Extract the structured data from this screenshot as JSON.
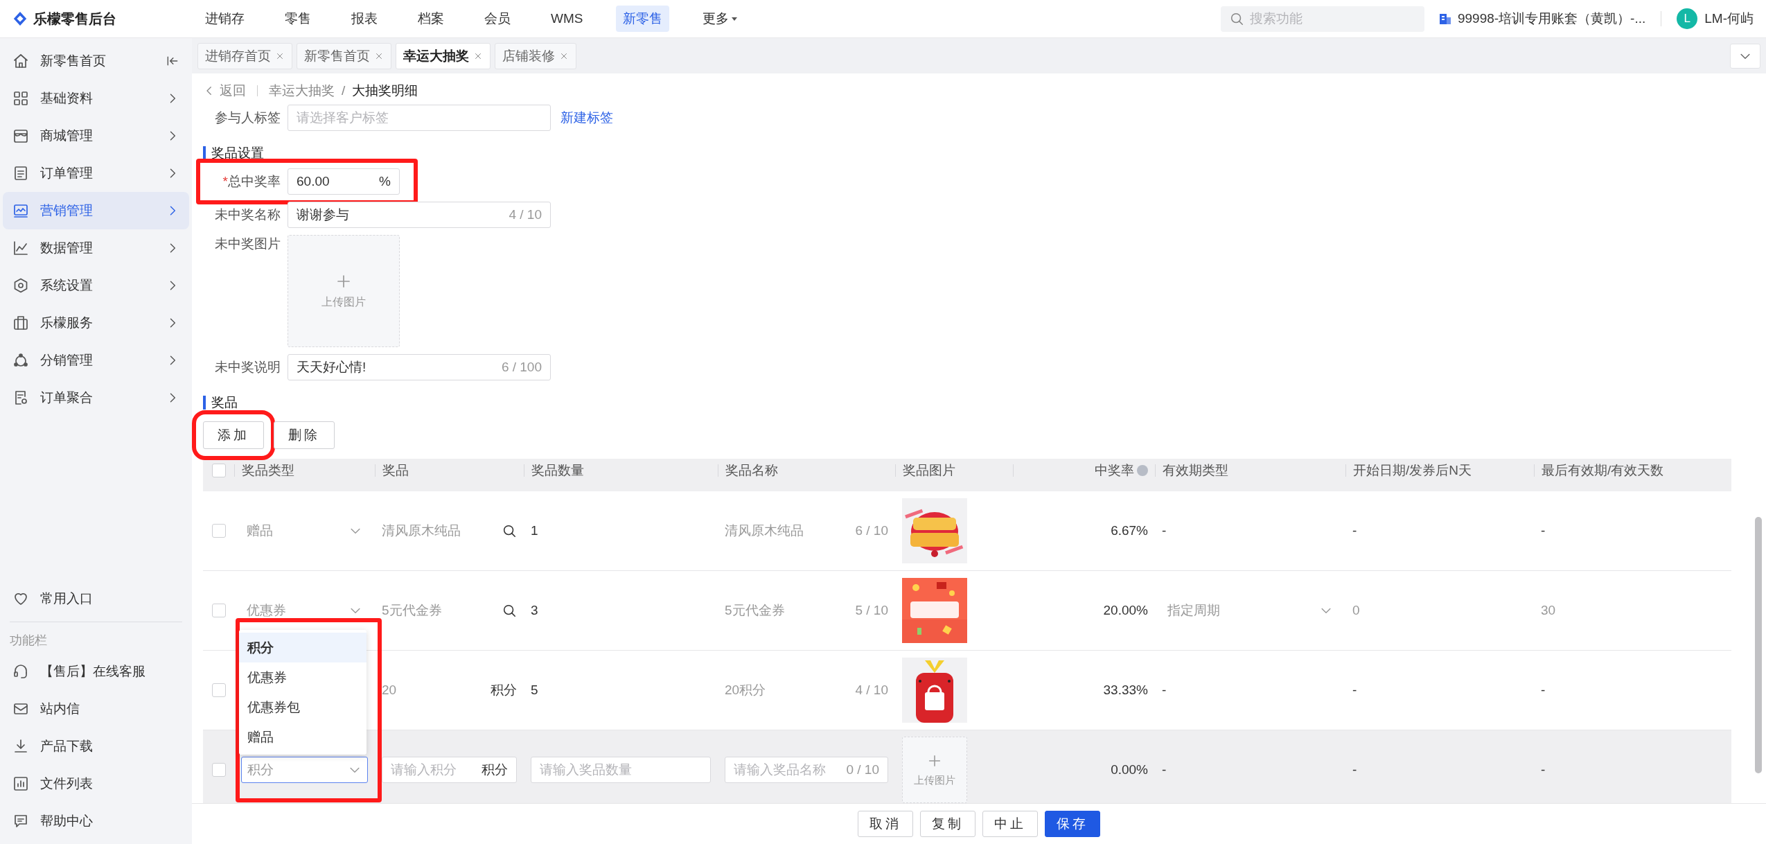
{
  "app": {
    "title": "乐檬零售后台"
  },
  "top_nav": [
    {
      "label": "进销存",
      "selected": false,
      "kind": "link"
    },
    {
      "label": "零售",
      "selected": false,
      "kind": "link"
    },
    {
      "label": "报表",
      "selected": false,
      "kind": "link"
    },
    {
      "label": "档案",
      "selected": false,
      "kind": "link"
    },
    {
      "label": "会员",
      "selected": false,
      "kind": "link"
    },
    {
      "label": "WMS",
      "selected": false,
      "kind": "link"
    },
    {
      "label": "新零售",
      "selected": true,
      "kind": "link"
    },
    {
      "label": "更多",
      "selected": false,
      "kind": "menu"
    }
  ],
  "search": {
    "placeholder": "搜索功能"
  },
  "account": {
    "label": "99998-培训专用账套（黄凯）-..."
  },
  "user": {
    "initial": "L",
    "name": "LM-何屿"
  },
  "sidebar": {
    "items": [
      {
        "label": "新零售首页",
        "selected": false,
        "kind": "collapse"
      },
      {
        "label": "基础资料",
        "selected": false,
        "kind": "chevron"
      },
      {
        "label": "商城管理",
        "selected": false,
        "kind": "chevron"
      },
      {
        "label": "订单管理",
        "selected": false,
        "kind": "chevron"
      },
      {
        "label": "营销管理",
        "selected": true,
        "kind": "chevron"
      },
      {
        "label": "数据管理",
        "selected": false,
        "kind": "chevron"
      },
      {
        "label": "系统设置",
        "selected": false,
        "kind": "chevron"
      },
      {
        "label": "乐檬服务",
        "selected": false,
        "kind": "chevron"
      },
      {
        "label": "分销管理",
        "selected": false,
        "kind": "chevron"
      },
      {
        "label": "订单聚合",
        "selected": false,
        "kind": "chevron"
      }
    ],
    "favorites": {
      "label": "常用入口"
    },
    "section_title": "功能栏",
    "tools": [
      {
        "label": "【售后】在线客服"
      },
      {
        "label": "站内信"
      },
      {
        "label": "产品下载"
      },
      {
        "label": "文件列表"
      },
      {
        "label": "帮助中心"
      }
    ]
  },
  "tabs": [
    {
      "label": "进销存首页",
      "selected": false
    },
    {
      "label": "新零售首页",
      "selected": false
    },
    {
      "label": "幸运大抽奖",
      "selected": true
    },
    {
      "label": "店铺装修",
      "selected": false
    }
  ],
  "breadcrumb": {
    "back": "返回",
    "separator": "/",
    "items": [
      "幸运大抽奖",
      "大抽奖明细"
    ]
  },
  "form": {
    "participant_tag": {
      "label": "参与人标签",
      "placeholder": "请选择客户标签",
      "link": "新建标签"
    },
    "prize_settings": {
      "title": "奖品设置",
      "total_rate": {
        "label": "总中奖率",
        "required": true,
        "required_mark": "*",
        "value": "60.00",
        "suffix": "%",
        "highlighted": true
      },
      "no_win_name": {
        "label": "未中奖名称",
        "value": "谢谢参与",
        "counter": "4 / 10"
      },
      "no_win_picture": {
        "label": "未中奖图片",
        "upload": "上传图片"
      },
      "no_win_note": {
        "label": "未中奖说明",
        "value": "天天好心情!",
        "counter": "6 / 100"
      }
    },
    "prizes": {
      "title": "奖品",
      "buttons": [
        {
          "label": "添加",
          "highlighted": true
        },
        {
          "label": "删除",
          "highlighted": false
        }
      ],
      "table": {
        "all_checked": false,
        "columns": [
          {
            "label": "奖品类型",
            "kind": "plain"
          },
          {
            "label": "奖品",
            "kind": "plain"
          },
          {
            "label": "奖品数量",
            "kind": "plain"
          },
          {
            "label": "奖品名称",
            "kind": "plain"
          },
          {
            "label": "奖品图片",
            "kind": "plain"
          },
          {
            "label": "中奖率",
            "kind": "help"
          },
          {
            "label": "有效期类型",
            "kind": "plain"
          },
          {
            "label": "开始日期/发券后N天",
            "kind": "plain"
          },
          {
            "label": "最后有效期/有效天数",
            "kind": "plain"
          }
        ],
        "rows": [
          {
            "kind": "saved",
            "checked": false,
            "type": {
              "value": "赠品"
            },
            "prize": {
              "kind": "lookup",
              "value": "清风原木纯品"
            },
            "quantity": {
              "value": "1"
            },
            "name": {
              "value": "清风原木纯品",
              "counter": "6 / 10"
            },
            "rate": "6.67%",
            "validity": {
              "kind": "text",
              "value": "-"
            },
            "start": {
              "kind": "text",
              "value": "-"
            },
            "end": {
              "kind": "text",
              "value": "-"
            }
          },
          {
            "kind": "saved",
            "checked": false,
            "type": {
              "value": "优惠券"
            },
            "prize": {
              "kind": "lookup",
              "value": "5元代金券"
            },
            "quantity": {
              "value": "3"
            },
            "name": {
              "value": "5元代金券",
              "counter": "5 / 10"
            },
            "rate": "20.00%",
            "validity": {
              "kind": "select",
              "value": "指定周期"
            },
            "start": {
              "kind": "input",
              "value": "0"
            },
            "end": {
              "kind": "input",
              "value": "30"
            }
          },
          {
            "kind": "saved",
            "checked": false,
            "prize": {
              "kind": "points",
              "value": "20",
              "suffix": "积分"
            },
            "quantity": {
              "value": "5"
            },
            "name": {
              "value": "20积分",
              "counter": "4 / 10"
            },
            "rate": "33.33%",
            "validity": {
              "kind": "text",
              "value": "-"
            },
            "start": {
              "kind": "text",
              "value": "-"
            },
            "end": {
              "kind": "text",
              "value": "-"
            }
          },
          {
            "kind": "new",
            "checked": false,
            "type": {
              "placeholder": "积分",
              "focused": true
            },
            "prize": {
              "kind": "points",
              "placeholder": "请输入积分",
              "suffix": "积分"
            },
            "quantity": {
              "placeholder": "请输入奖品数量"
            },
            "name": {
              "placeholder": "请输入奖品名称",
              "counter": "0 / 10"
            },
            "picture": {
              "kind": "upload",
              "label": "上传图片"
            },
            "rate": "0.00%",
            "validity": {
              "kind": "text",
              "value": "-"
            },
            "start": {
              "kind": "text",
              "value": "-"
            },
            "end": {
              "kind": "text",
              "value": "-"
            }
          }
        ],
        "type_dropdown": {
          "highlighted": true,
          "options": [
            {
              "label": "积分",
              "selected": true
            },
            {
              "label": "优惠券",
              "selected": false
            },
            {
              "label": "优惠券包",
              "selected": false
            },
            {
              "label": "赠品",
              "selected": false
            }
          ]
        }
      }
    }
  },
  "footer": {
    "buttons": [
      {
        "label": "取消",
        "kind": "default"
      },
      {
        "label": "复制",
        "kind": "default"
      },
      {
        "label": "中止",
        "kind": "default"
      },
      {
        "label": "保存",
        "kind": "primary"
      }
    ]
  }
}
